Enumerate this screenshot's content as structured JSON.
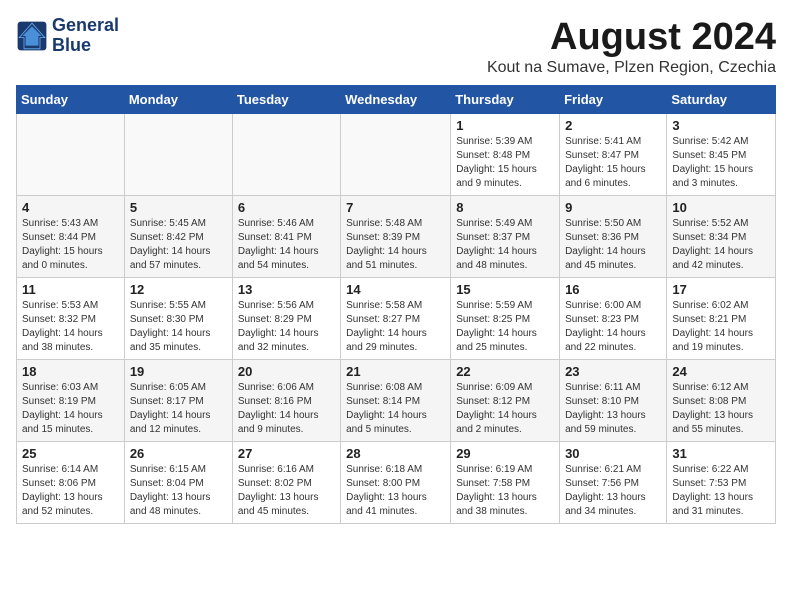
{
  "logo": {
    "line1": "General",
    "line2": "Blue"
  },
  "title": "August 2024",
  "subtitle": "Kout na Sumave, Plzen Region, Czechia",
  "weekdays": [
    "Sunday",
    "Monday",
    "Tuesday",
    "Wednesday",
    "Thursday",
    "Friday",
    "Saturday"
  ],
  "weeks": [
    [
      {
        "day": "",
        "info": ""
      },
      {
        "day": "",
        "info": ""
      },
      {
        "day": "",
        "info": ""
      },
      {
        "day": "",
        "info": ""
      },
      {
        "day": "1",
        "info": "Sunrise: 5:39 AM\nSunset: 8:48 PM\nDaylight: 15 hours\nand 9 minutes."
      },
      {
        "day": "2",
        "info": "Sunrise: 5:41 AM\nSunset: 8:47 PM\nDaylight: 15 hours\nand 6 minutes."
      },
      {
        "day": "3",
        "info": "Sunrise: 5:42 AM\nSunset: 8:45 PM\nDaylight: 15 hours\nand 3 minutes."
      }
    ],
    [
      {
        "day": "4",
        "info": "Sunrise: 5:43 AM\nSunset: 8:44 PM\nDaylight: 15 hours\nand 0 minutes."
      },
      {
        "day": "5",
        "info": "Sunrise: 5:45 AM\nSunset: 8:42 PM\nDaylight: 14 hours\nand 57 minutes."
      },
      {
        "day": "6",
        "info": "Sunrise: 5:46 AM\nSunset: 8:41 PM\nDaylight: 14 hours\nand 54 minutes."
      },
      {
        "day": "7",
        "info": "Sunrise: 5:48 AM\nSunset: 8:39 PM\nDaylight: 14 hours\nand 51 minutes."
      },
      {
        "day": "8",
        "info": "Sunrise: 5:49 AM\nSunset: 8:37 PM\nDaylight: 14 hours\nand 48 minutes."
      },
      {
        "day": "9",
        "info": "Sunrise: 5:50 AM\nSunset: 8:36 PM\nDaylight: 14 hours\nand 45 minutes."
      },
      {
        "day": "10",
        "info": "Sunrise: 5:52 AM\nSunset: 8:34 PM\nDaylight: 14 hours\nand 42 minutes."
      }
    ],
    [
      {
        "day": "11",
        "info": "Sunrise: 5:53 AM\nSunset: 8:32 PM\nDaylight: 14 hours\nand 38 minutes."
      },
      {
        "day": "12",
        "info": "Sunrise: 5:55 AM\nSunset: 8:30 PM\nDaylight: 14 hours\nand 35 minutes."
      },
      {
        "day": "13",
        "info": "Sunrise: 5:56 AM\nSunset: 8:29 PM\nDaylight: 14 hours\nand 32 minutes."
      },
      {
        "day": "14",
        "info": "Sunrise: 5:58 AM\nSunset: 8:27 PM\nDaylight: 14 hours\nand 29 minutes."
      },
      {
        "day": "15",
        "info": "Sunrise: 5:59 AM\nSunset: 8:25 PM\nDaylight: 14 hours\nand 25 minutes."
      },
      {
        "day": "16",
        "info": "Sunrise: 6:00 AM\nSunset: 8:23 PM\nDaylight: 14 hours\nand 22 minutes."
      },
      {
        "day": "17",
        "info": "Sunrise: 6:02 AM\nSunset: 8:21 PM\nDaylight: 14 hours\nand 19 minutes."
      }
    ],
    [
      {
        "day": "18",
        "info": "Sunrise: 6:03 AM\nSunset: 8:19 PM\nDaylight: 14 hours\nand 15 minutes."
      },
      {
        "day": "19",
        "info": "Sunrise: 6:05 AM\nSunset: 8:17 PM\nDaylight: 14 hours\nand 12 minutes."
      },
      {
        "day": "20",
        "info": "Sunrise: 6:06 AM\nSunset: 8:16 PM\nDaylight: 14 hours\nand 9 minutes."
      },
      {
        "day": "21",
        "info": "Sunrise: 6:08 AM\nSunset: 8:14 PM\nDaylight: 14 hours\nand 5 minutes."
      },
      {
        "day": "22",
        "info": "Sunrise: 6:09 AM\nSunset: 8:12 PM\nDaylight: 14 hours\nand 2 minutes."
      },
      {
        "day": "23",
        "info": "Sunrise: 6:11 AM\nSunset: 8:10 PM\nDaylight: 13 hours\nand 59 minutes."
      },
      {
        "day": "24",
        "info": "Sunrise: 6:12 AM\nSunset: 8:08 PM\nDaylight: 13 hours\nand 55 minutes."
      }
    ],
    [
      {
        "day": "25",
        "info": "Sunrise: 6:14 AM\nSunset: 8:06 PM\nDaylight: 13 hours\nand 52 minutes."
      },
      {
        "day": "26",
        "info": "Sunrise: 6:15 AM\nSunset: 8:04 PM\nDaylight: 13 hours\nand 48 minutes."
      },
      {
        "day": "27",
        "info": "Sunrise: 6:16 AM\nSunset: 8:02 PM\nDaylight: 13 hours\nand 45 minutes."
      },
      {
        "day": "28",
        "info": "Sunrise: 6:18 AM\nSunset: 8:00 PM\nDaylight: 13 hours\nand 41 minutes."
      },
      {
        "day": "29",
        "info": "Sunrise: 6:19 AM\nSunset: 7:58 PM\nDaylight: 13 hours\nand 38 minutes."
      },
      {
        "day": "30",
        "info": "Sunrise: 6:21 AM\nSunset: 7:56 PM\nDaylight: 13 hours\nand 34 minutes."
      },
      {
        "day": "31",
        "info": "Sunrise: 6:22 AM\nSunset: 7:53 PM\nDaylight: 13 hours\nand 31 minutes."
      }
    ]
  ]
}
